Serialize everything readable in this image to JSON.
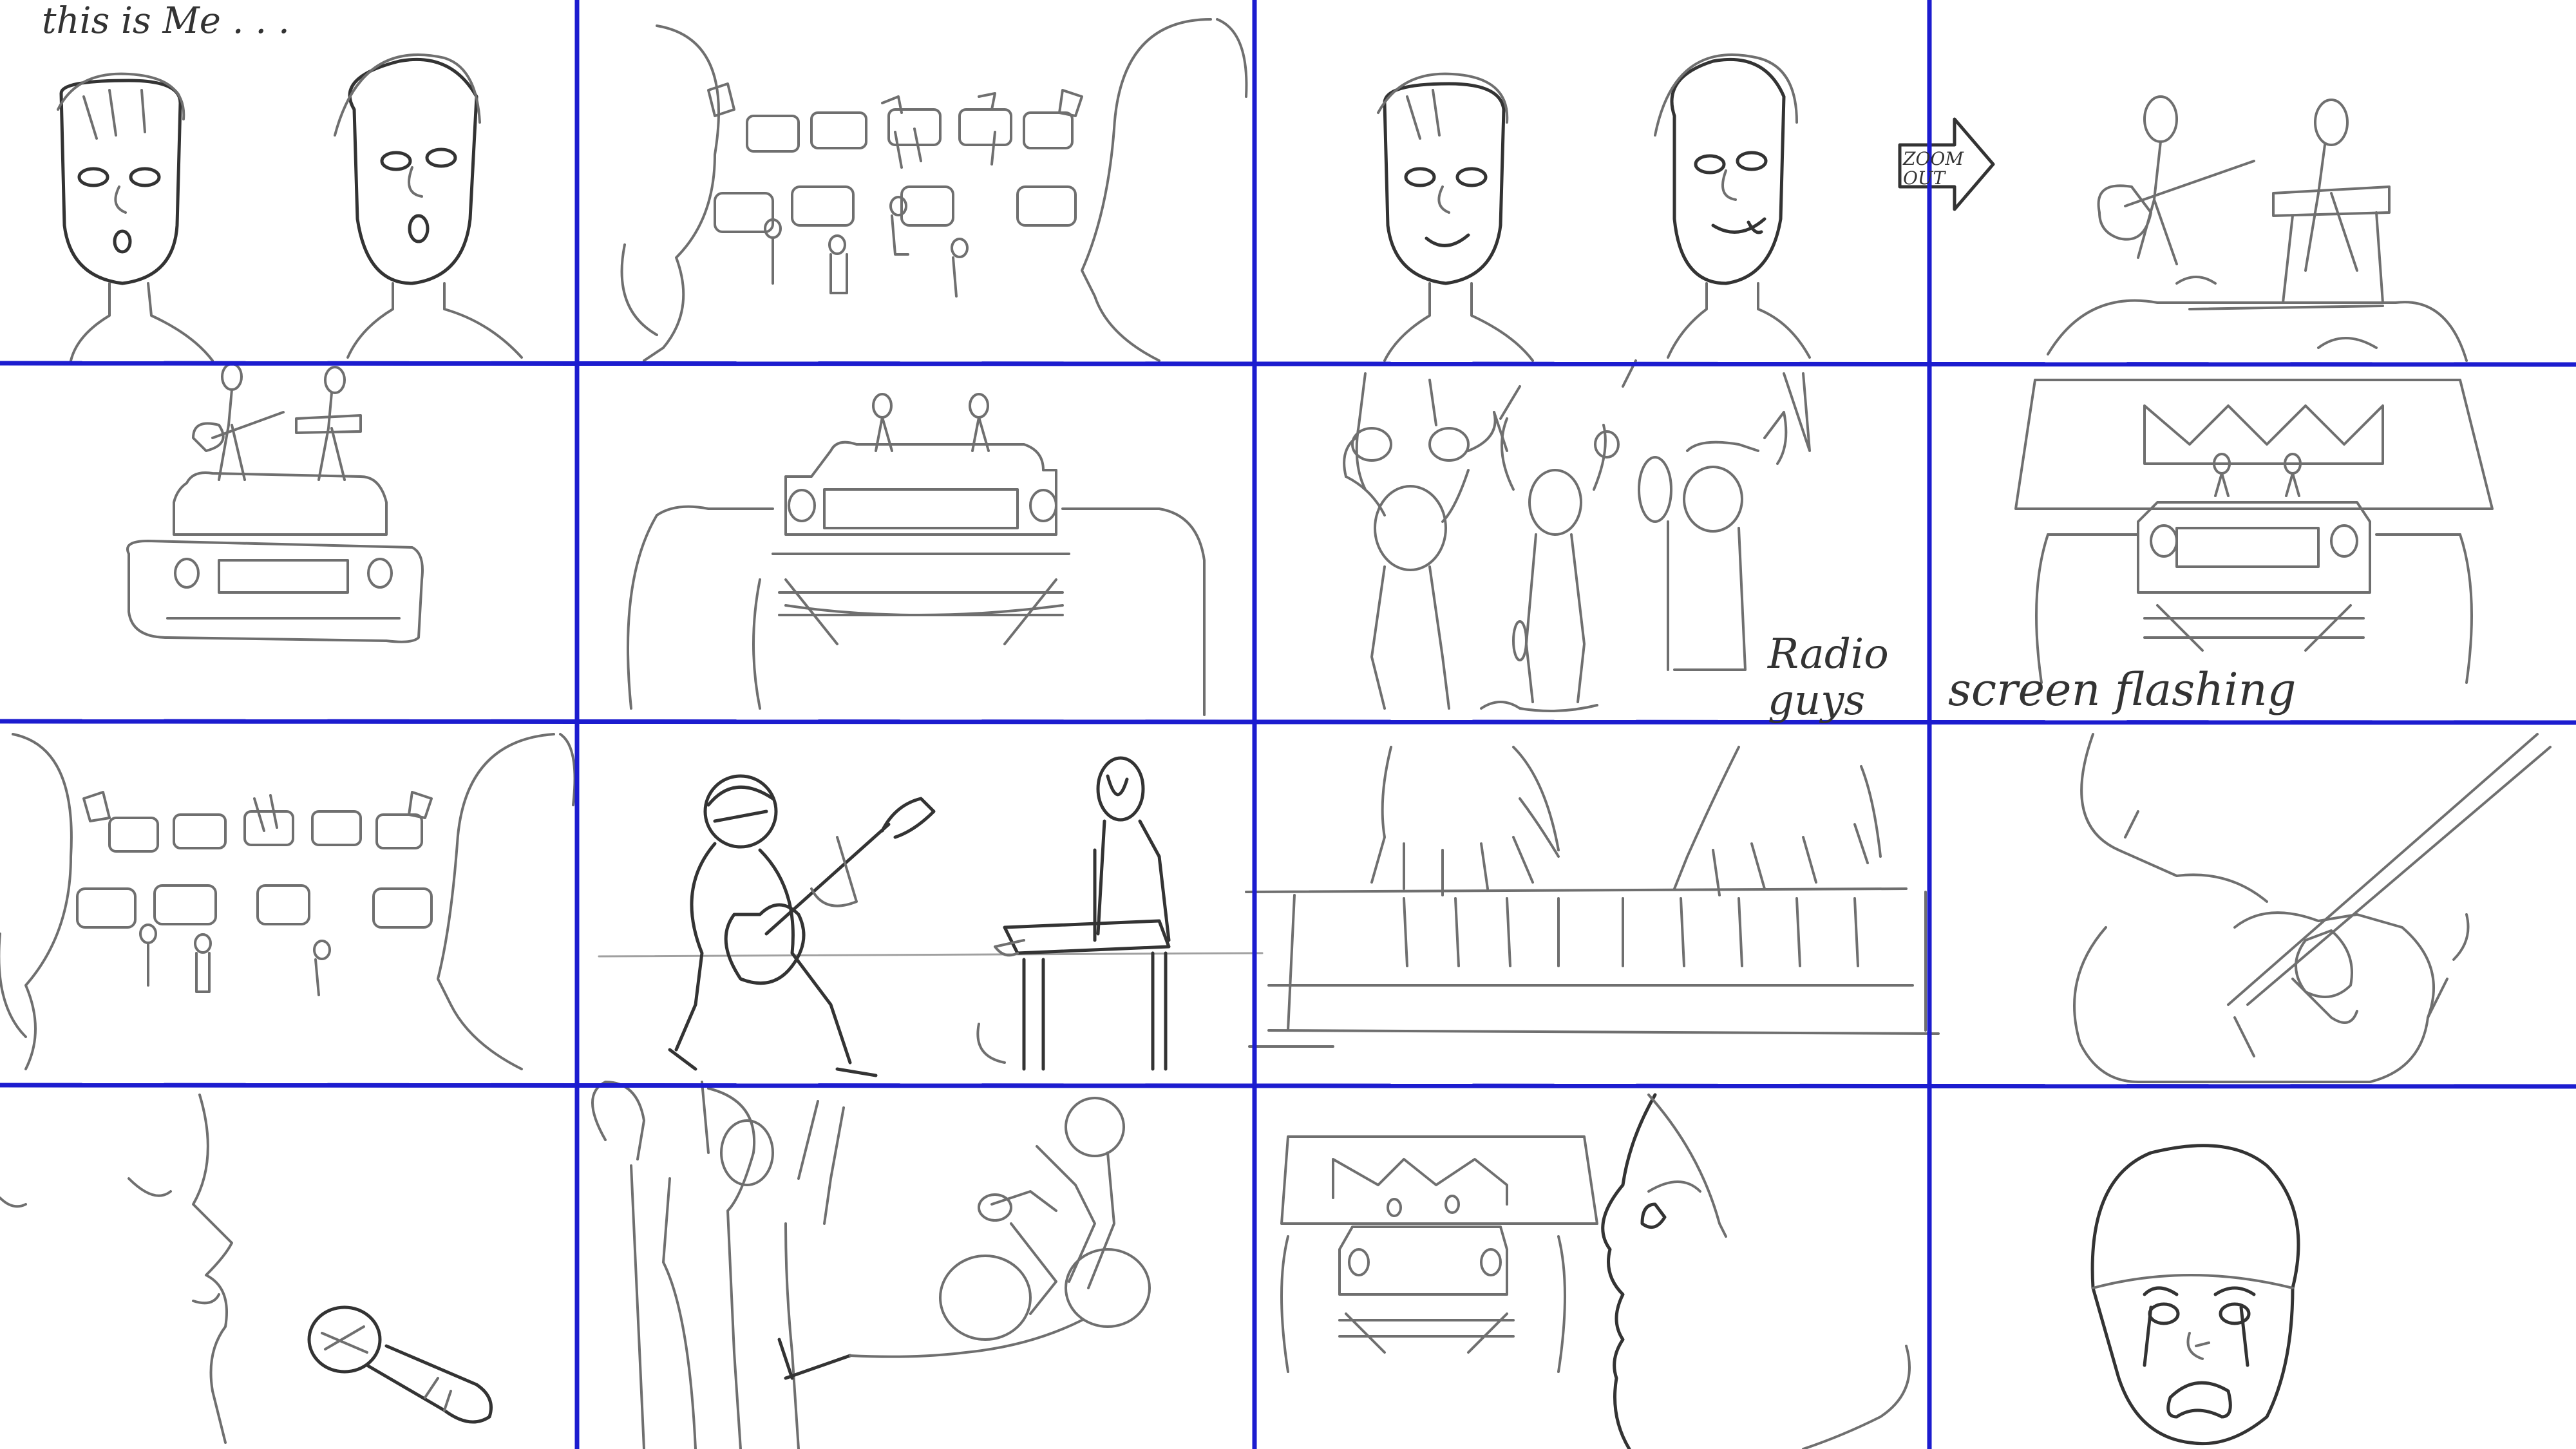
{
  "colors": {
    "grid_line": "#1c1ccf",
    "pencil": "#6f6f6f",
    "ink": "#333333",
    "paper": "#ffffff"
  },
  "board": {
    "rows": 4,
    "columns": 4,
    "notes": {
      "intro": "this is Me . . .",
      "zoom_label": "ZOOM OUT",
      "radio_guys": "Radio guys",
      "screen_flashing": "screen flashing"
    }
  },
  "panels": [
    {
      "row": 1,
      "col": 1,
      "scene": "two-faces-singing"
    },
    {
      "row": 1,
      "col": 2,
      "scene": "crowd-of-cars-between-heads"
    },
    {
      "row": 1,
      "col": 3,
      "scene": "two-faces-smiling"
    },
    {
      "row": 1,
      "col": 4,
      "scene": "band-on-stage-closeup"
    },
    {
      "row": 2,
      "col": 1,
      "scene": "band-on-car-roof"
    },
    {
      "row": 2,
      "col": 2,
      "scene": "car-on-stage-wide"
    },
    {
      "row": 2,
      "col": 3,
      "scene": "fans-cheering"
    },
    {
      "row": 2,
      "col": 4,
      "scene": "stage-with-screen"
    },
    {
      "row": 3,
      "col": 1,
      "scene": "crowd-of-cars-between-heads-repeat"
    },
    {
      "row": 3,
      "col": 2,
      "scene": "guitarist-and-keyboardist"
    },
    {
      "row": 3,
      "col": 3,
      "scene": "hands-on-keyboard"
    },
    {
      "row": 3,
      "col": 4,
      "scene": "guitar-closeup"
    },
    {
      "row": 4,
      "col": 1,
      "scene": "singer-with-microphone"
    },
    {
      "row": 4,
      "col": 2,
      "scene": "cyclist-behind-crowd"
    },
    {
      "row": 4,
      "col": 3,
      "scene": "face-watching-stage"
    },
    {
      "row": 4,
      "col": 4,
      "scene": "crying-helmet-rider"
    }
  ]
}
